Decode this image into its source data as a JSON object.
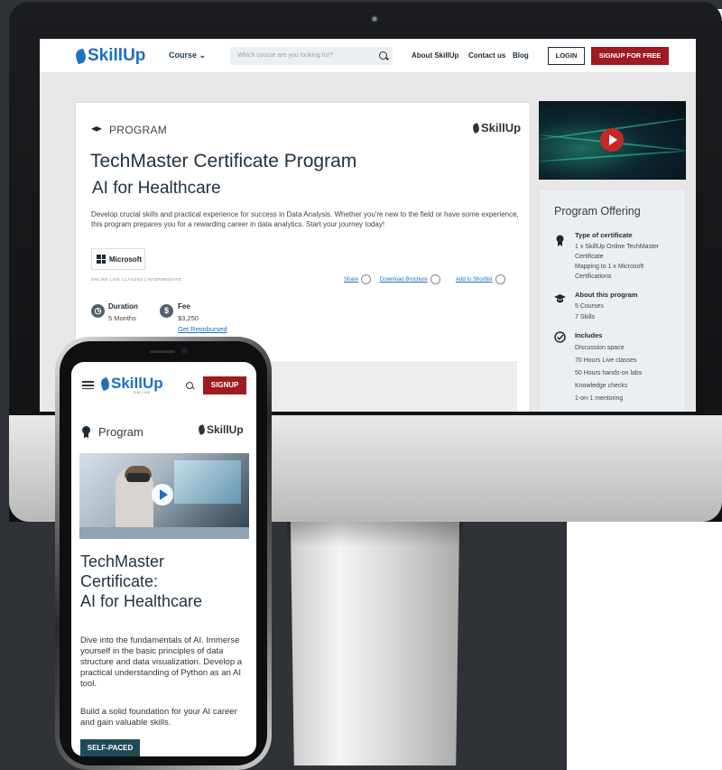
{
  "colors": {
    "brand_blue": "#1d6fc4",
    "brand_red": "#9e1b1f",
    "navy": "#1c2a36",
    "badge_teal": "#1f4b55",
    "backdrop_dark": "#2f3338"
  },
  "desktop": {
    "nav": {
      "logo": "SkillUp",
      "course_menu": "Course",
      "search_placeholder": "Which course are you looking for?",
      "links": [
        "About SkillUp",
        "Contact us",
        "Blog"
      ],
      "login": "LOGIN",
      "signup": "SIGNUP FOR FREE"
    },
    "program": {
      "label": "PROGRAM",
      "logo": "SkillUp",
      "title": "TechMaster Certificate Program",
      "subtitle": "AI for Healthcare",
      "description": "Develop crucial skills and practical experience for success in Data Analysis. Whether you're new to the field or have some experience, this program prepares you for a rewarding career in data analytics. Start your journey today!",
      "partner": "Microsoft",
      "meta": "ONLINE LIVE CLASSES | INTERMEDIATE",
      "actions": [
        "Share",
        "Download Brochure",
        "Add to Shortlist"
      ],
      "duration_label": "Duration",
      "duration_value": "5 Months",
      "fee_label": "Fee",
      "fee_value": "$3,250",
      "reimburse_link": "Get Reimbursed"
    },
    "offering": {
      "title": "Program Offering",
      "type_heading": "Type of certificate",
      "type_items": [
        "1 x SkillUp Online TechMaster Certificate",
        "Mapping to 1 x Microsoft Certifications"
      ],
      "about_heading": "About this program",
      "about_items": [
        "5 Courses",
        "7 Skills"
      ],
      "includes_heading": "Includes",
      "includes_items": [
        "Discussion space",
        "70 Hours Live classes",
        "50 Hours hands-on labs",
        "Knowledge checks",
        "1-on-1 mentoring"
      ]
    }
  },
  "mobile": {
    "logo": "SkillUp",
    "logo_tag": "ONLINE",
    "signup": "SIGNUP",
    "program_label": "Program",
    "program_logo": "SkillUp",
    "title_lines": [
      "TechMaster",
      "Certificate:",
      "AI for Healthcare"
    ],
    "description": "Dive into the fundamentals of AI. Immerse yourself in the basic principles of data structure and data visualization. Develop a practical understanding of Python as an AI tool.",
    "description2": "Build a solid foundation for your AI career and gain valuable skills.",
    "badge": "SELF-PACED"
  },
  "icons": {
    "search": "search-icon",
    "menu": "hamburger-menu-icon",
    "play": "play-icon",
    "graduation": "graduation-cap-icon",
    "ribbon": "certificate-ribbon-icon",
    "clock": "clock-icon",
    "dollar": "dollar-icon",
    "check": "check-circle-icon"
  }
}
